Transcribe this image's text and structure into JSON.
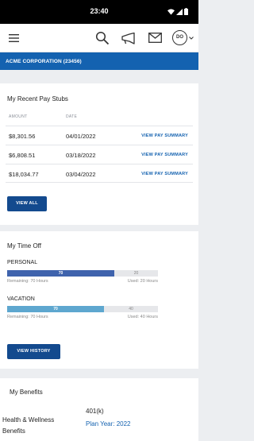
{
  "status": {
    "time": "23:40"
  },
  "header": {
    "avatar_initials": "DO",
    "icons": [
      "menu-icon",
      "search-icon",
      "megaphone-icon",
      "mail-icon",
      "avatar",
      "chevron-down-icon"
    ]
  },
  "company": {
    "name": "ACME CORPORATION (23456)"
  },
  "pay_stubs": {
    "title": "My Recent Pay Stubs",
    "col_amount": "AMOUNT",
    "col_date": "DATE",
    "rows": [
      {
        "amount": "$8,301.56",
        "date": "04/01/2022",
        "action": "VIEW PAY SUMMARY"
      },
      {
        "amount": "$6,808.51",
        "date": "03/18/2022",
        "action": "VIEW PAY SUMMARY"
      },
      {
        "amount": "$18,034.77",
        "date": "03/04/2022",
        "action": "VIEW PAY SUMMARY"
      }
    ],
    "view_all": "VIEW ALL"
  },
  "time_off": {
    "title": "My Time Off",
    "items": [
      {
        "label": "PERSONAL",
        "used": 70,
        "remaining_bar": 20,
        "fill_fraction": 0.71,
        "color": "#3f63ad",
        "remaining_text": "Remaining: 70 Hours",
        "used_text": "Used: 20 Hours"
      },
      {
        "label": "VACATION",
        "used": 70,
        "remaining_bar": 40,
        "fill_fraction": 0.64,
        "color": "#5ea7cf",
        "remaining_text": "Remaining: 70 Hours",
        "used_text": "Used: 40 Hours"
      }
    ],
    "view_history": "VIEW HISTORY"
  },
  "benefits": {
    "title": "My Benefits",
    "plan_name": "401(k)",
    "section_label": "Health & Wellness",
    "section_label_2": "Benefits",
    "plan_year": "Plan Year: 2022",
    "plan_year_color": "#1462b0"
  },
  "colors": {
    "brand_blue": "#1462b0",
    "button_navy": "#134a8e"
  }
}
